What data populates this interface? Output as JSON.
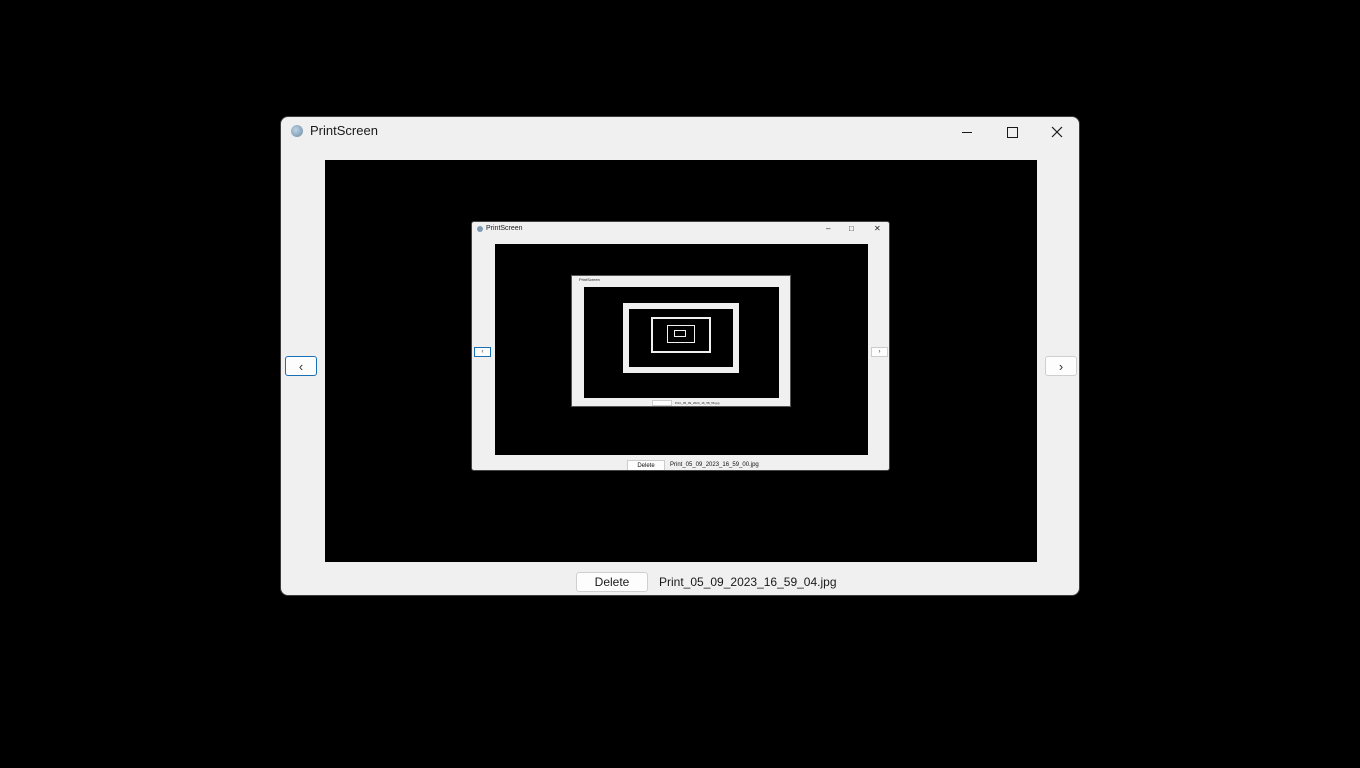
{
  "window": {
    "title": "PrintScreen",
    "minimize_icon": "minimize-icon",
    "maximize_icon": "maximize-icon",
    "close_icon": "close-icon"
  },
  "nav": {
    "prev_label": "‹",
    "next_label": "›"
  },
  "footer": {
    "delete_label": "Delete",
    "filename": "Print_05_09_2023_16_59_04.jpg"
  },
  "nested": {
    "title": "PrintScreen",
    "delete_label": "Delete",
    "filename": "Print_05_09_2023_16_59_00.jpg",
    "prev_label": "‹",
    "next_label": "›",
    "level2_title": "PrintScreen",
    "level2_filename": "Print_05_09_2023_16_58_56.jpg"
  }
}
